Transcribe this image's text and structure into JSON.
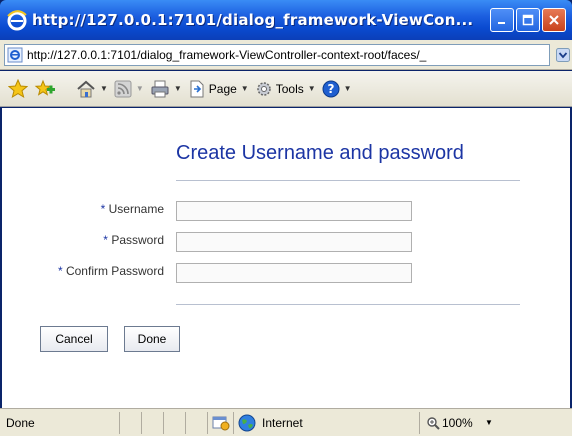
{
  "window": {
    "title": "http://127.0.0.1:7101/dialog_framework-ViewCon..."
  },
  "address": {
    "url": "http://127.0.0.1:7101/dialog_framework-ViewController-context-root/faces/_"
  },
  "toolbar": {
    "page_label": "Page",
    "tools_label": "Tools"
  },
  "dialog": {
    "title": "Create Username and password",
    "required_marker": "*",
    "fields": [
      {
        "label": "Username",
        "value": ""
      },
      {
        "label": "Password",
        "value": ""
      },
      {
        "label": "Confirm Password",
        "value": ""
      }
    ],
    "cancel_label": "Cancel",
    "done_label": "Done"
  },
  "status": {
    "text": "Done",
    "zone": "Internet",
    "zoom": "100%"
  },
  "colors": {
    "accent": "#1c35a4",
    "titlebar": "#0a4ad0"
  }
}
